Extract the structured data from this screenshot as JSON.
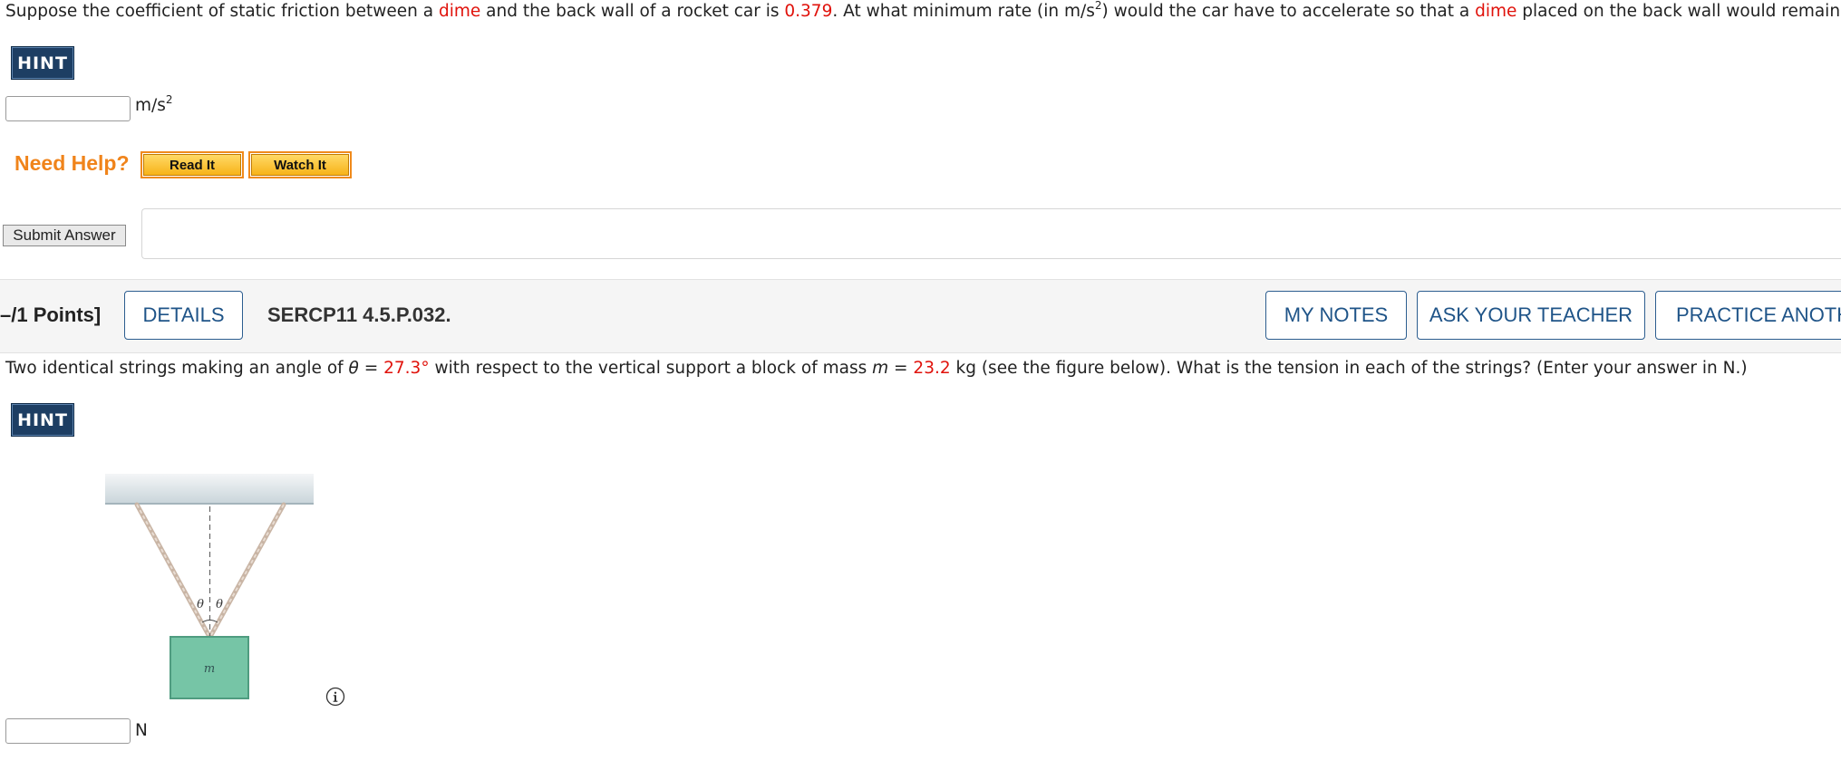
{
  "q1": {
    "text_a": "Suppose the coefficient of static friction between a ",
    "dime1": "dime",
    "text_b": " and the back wall of a rocket car is ",
    "coef": "0.379",
    "text_c": ". At what minimum rate (in m/s",
    "sup": "2",
    "text_d": ") would the car have to accelerate so that a ",
    "dime2": "dime",
    "text_e": " placed on the back wall would remain in place?",
    "hint_label": "HINT",
    "unit_base": "m/s",
    "unit_sup": "2",
    "need_help": "Need Help?",
    "read_it": "Read It",
    "watch_it": "Watch It",
    "submit": "Submit Answer"
  },
  "q2_header": {
    "points": "–/1 Points]",
    "details": "DETAILS",
    "problem_id": "SERCP11 4.5.P.032.",
    "my_notes": "MY NOTES",
    "ask_teacher": "ASK YOUR TEACHER",
    "practice": "PRACTICE ANOTH"
  },
  "q2": {
    "text_a": "Two identical strings making an angle of ",
    "theta": "θ",
    "eq1": " = ",
    "angle": "27.3°",
    "text_b": " with respect to the vertical support a block of mass ",
    "m": "m",
    "eq2": " = ",
    "mass": "23.2",
    "text_c": " kg (see the figure below). What is the tension in each of the strings? (Enter your answer in N.)",
    "hint_label": "HINT",
    "figure": {
      "angle_left": "θ",
      "angle_right": "θ",
      "block_label": "m"
    },
    "unit": "N"
  },
  "colors": {
    "accent": "#1d3e63",
    "value_red": "#e0120b",
    "help_orange": "#f0841b",
    "link_blue": "#1f5488",
    "block_green": "#76c5a6"
  }
}
